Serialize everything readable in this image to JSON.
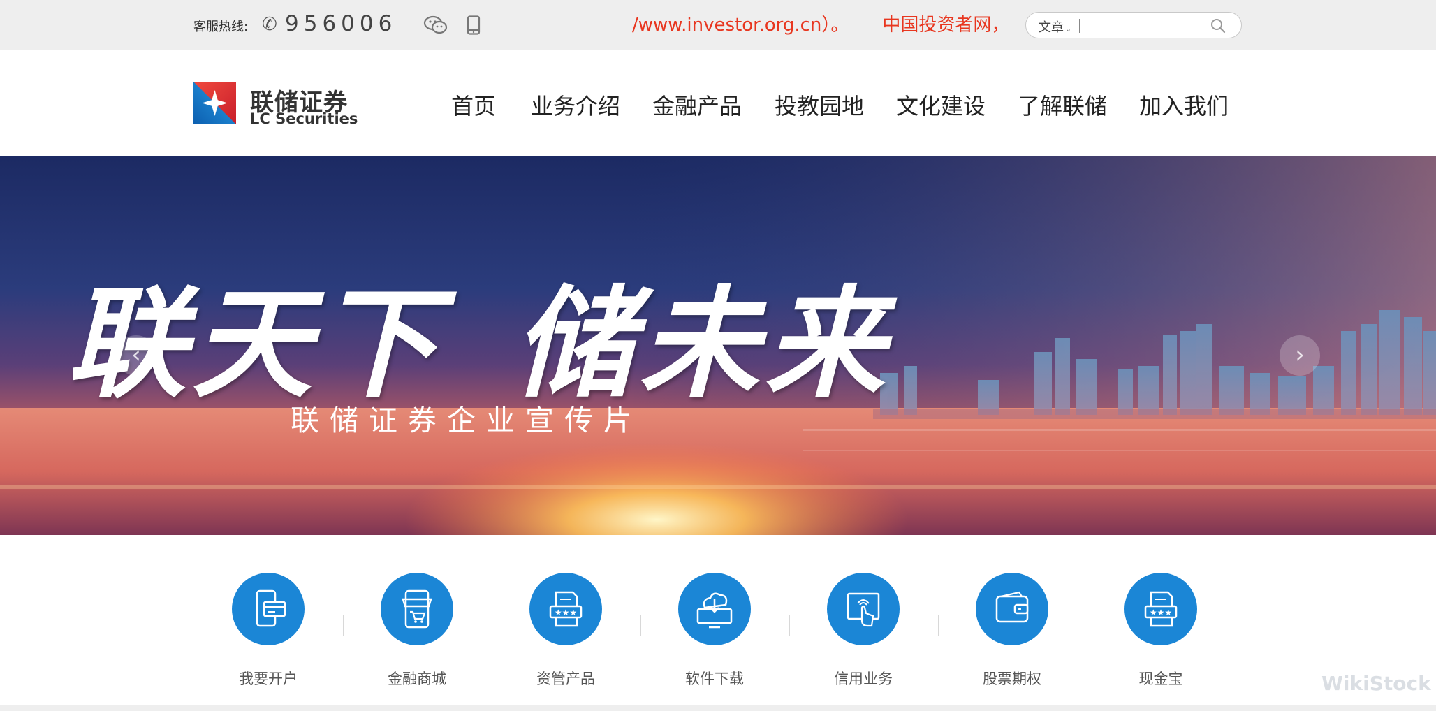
{
  "topbar": {
    "hotline_label": "客服热线:",
    "hotline_number": "956006",
    "ticker_text_1": "/www.investor.org.cn）。",
    "ticker_text_2": "中国投资者网，投资者",
    "search": {
      "category": "文章",
      "placeholder": ""
    }
  },
  "header": {
    "logo_cn": "联储证券",
    "logo_en": "LC Securities",
    "nav": [
      "首页",
      "业务介绍",
      "金融产品",
      "投教园地",
      "文化建设",
      "了解联储",
      "加入我们"
    ]
  },
  "banner": {
    "slogan_1": "联天下",
    "slogan_2": "储未来",
    "subtitle": "联储证券企业宣传片"
  },
  "quick_links": [
    {
      "label": "我要开户",
      "icon": "mobile-card-icon"
    },
    {
      "label": "金融商城",
      "icon": "shop-icon"
    },
    {
      "label": "资管产品",
      "icon": "document-stars-icon"
    },
    {
      "label": "软件下载",
      "icon": "cloud-download-icon"
    },
    {
      "label": "信用业务",
      "icon": "touch-card-icon"
    },
    {
      "label": "股票期权",
      "icon": "wallet-icon"
    },
    {
      "label": "现金宝",
      "icon": "certificate-icon"
    }
  ],
  "watermark": "WikiStock",
  "colors": {
    "accent_blue": "#1b86d6",
    "ticker_red": "#e8361f",
    "topbar_bg": "#eeeeee"
  }
}
